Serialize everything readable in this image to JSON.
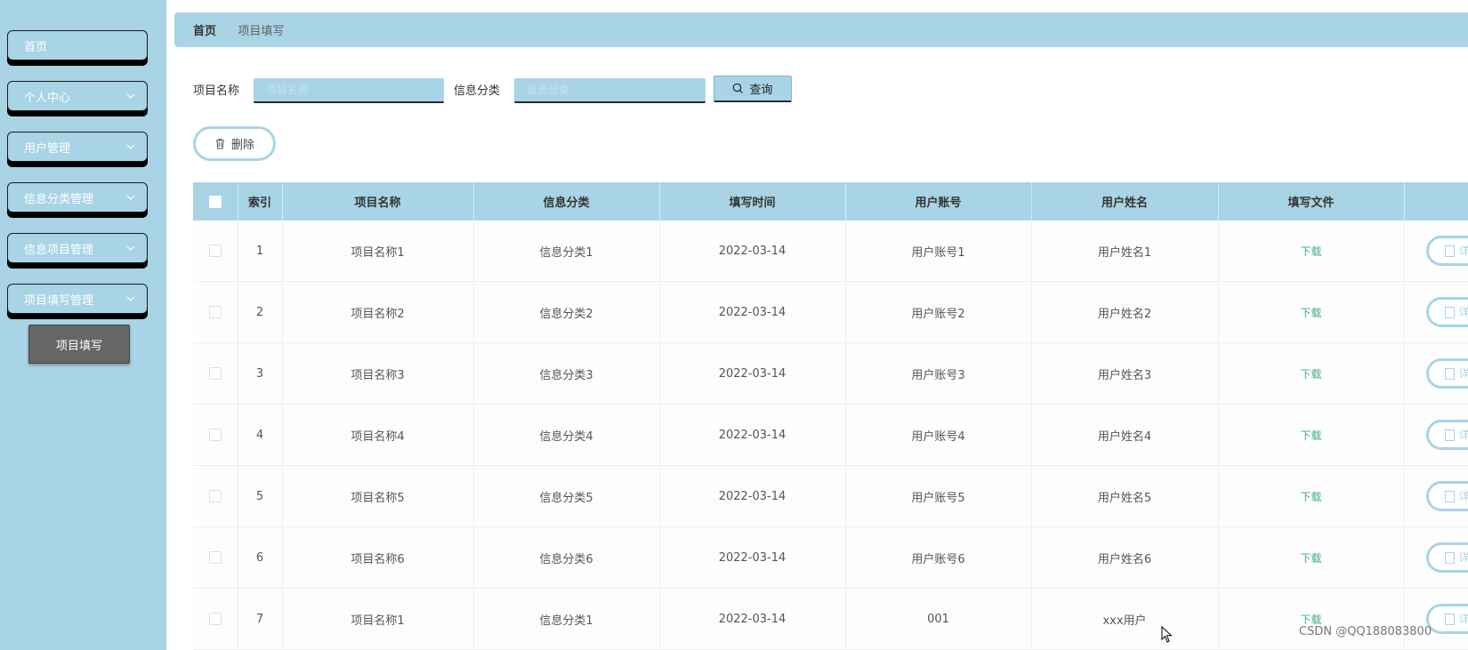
{
  "sidebar": {
    "items": [
      {
        "label": "首页"
      },
      {
        "label": "个人中心"
      },
      {
        "label": "用户管理"
      },
      {
        "label": "信息分类管理"
      },
      {
        "label": "信息项目管理"
      },
      {
        "label": "项目填写管理"
      }
    ],
    "active_sub": "项目填写"
  },
  "breadcrumb": {
    "home": "首页",
    "separator": "/",
    "current": "项目填写"
  },
  "search": {
    "name_label": "项目名称",
    "name_placeholder": "项目名称",
    "category_label": "信息分类",
    "category_placeholder": "信息分类",
    "query_label": "查询"
  },
  "actions": {
    "delete_label": "删除"
  },
  "table": {
    "headers": [
      "索引",
      "项目名称",
      "信息分类",
      "填写时间",
      "用户账号",
      "用户姓名",
      "填写文件"
    ],
    "download_label": "下载",
    "detail_label": "详情",
    "rows": [
      {
        "index": "1",
        "name": "项目名称1",
        "category": "信息分类1",
        "time": "2022-03-14",
        "account": "用户账号1",
        "username": "用户姓名1"
      },
      {
        "index": "2",
        "name": "项目名称2",
        "category": "信息分类2",
        "time": "2022-03-14",
        "account": "用户账号2",
        "username": "用户姓名2"
      },
      {
        "index": "3",
        "name": "项目名称3",
        "category": "信息分类3",
        "time": "2022-03-14",
        "account": "用户账号3",
        "username": "用户姓名3"
      },
      {
        "index": "4",
        "name": "项目名称4",
        "category": "信息分类4",
        "time": "2022-03-14",
        "account": "用户账号4",
        "username": "用户姓名4"
      },
      {
        "index": "5",
        "name": "项目名称5",
        "category": "信息分类5",
        "time": "2022-03-14",
        "account": "用户账号5",
        "username": "用户姓名5"
      },
      {
        "index": "6",
        "name": "项目名称6",
        "category": "信息分类6",
        "time": "2022-03-14",
        "account": "用户账号6",
        "username": "用户姓名6"
      },
      {
        "index": "7",
        "name": "项目名称1",
        "category": "信息分类1",
        "time": "2022-03-14",
        "account": "001",
        "username": "xxx用户"
      }
    ]
  },
  "watermark": "CSDN @QQ188083800",
  "colors": {
    "accent": "#a8d4e6",
    "download": "#3fae8c",
    "submenu_active": "#666666"
  }
}
